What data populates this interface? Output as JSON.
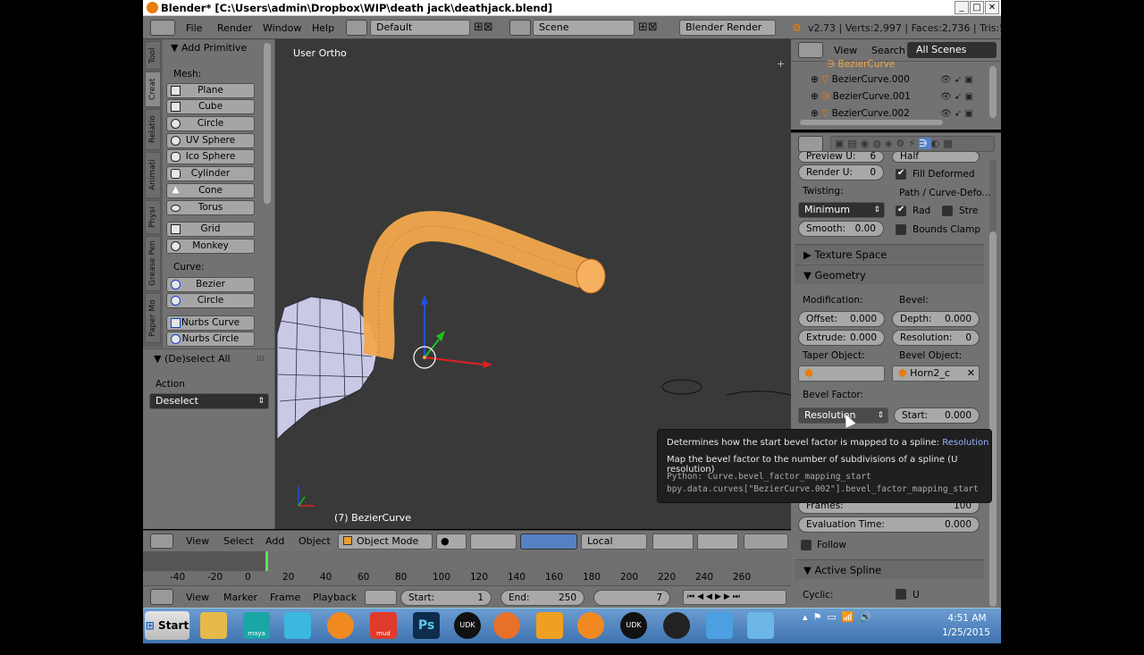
{
  "window": {
    "title": "Blender* [C:\\Users\\admin\\Dropbox\\WIP\\death jack\\deathjack.blend]",
    "min": "_",
    "max": "□",
    "close": "✕"
  },
  "topbar": {
    "menus": [
      "File",
      "Render",
      "Window",
      "Help"
    ],
    "layout": "Default",
    "scene": "Scene",
    "engine": "Blender Render",
    "stats": "v2.73 | Verts:2,997 | Faces:2,736 | Tris:5,51"
  },
  "toolshelf": {
    "tabs": [
      "Tool",
      "Creat",
      "Relatio",
      "Animati",
      "Physi",
      "Grease Pen",
      "Paper Mo"
    ],
    "add_primitive": "Add Primitive",
    "mesh_label": "Mesh:",
    "mesh": [
      "Plane",
      "Cube",
      "Circle",
      "UV Sphere",
      "Ico Sphere",
      "Cylinder",
      "Cone",
      "Torus"
    ],
    "other": [
      "Grid",
      "Monkey"
    ],
    "curve_label": "Curve:",
    "curves": [
      "Bezier",
      "Circle",
      "Nurbs Curve",
      "Nurbs Circle"
    ],
    "deselect_panel": "(De)select All",
    "action_label": "Action",
    "action_value": "Deselect"
  },
  "viewport": {
    "label": "User Ortho",
    "object": "(7) BezierCurve"
  },
  "vphdr": {
    "menus": [
      "View",
      "Select",
      "Add",
      "Object"
    ],
    "mode": "Object Mode",
    "pivot": "Local"
  },
  "timeline": {
    "ticks": [
      "-40",
      "-20",
      "0",
      "20",
      "40",
      "60",
      "80",
      "100",
      "120",
      "140",
      "160",
      "180",
      "200",
      "220",
      "240",
      "260"
    ]
  },
  "tlhdr": {
    "menus": [
      "View",
      "Marker",
      "Frame",
      "Playback"
    ],
    "start_label": "Start:",
    "start": "1",
    "end_label": "End:",
    "end": "250",
    "current": "7"
  },
  "outliner": {
    "menus": [
      "View",
      "Search"
    ],
    "filter": "All Scenes",
    "items": [
      "BezierCurve",
      "BezierCurve.000",
      "BezierCurve.001",
      "BezierCurve.002"
    ]
  },
  "props": {
    "preview_u": "Preview U:",
    "preview_u_val": "6",
    "render_u": "Render U:",
    "render_u_val": "0",
    "half": "Half",
    "fill_deformed": "Fill Deformed",
    "twisting": "Twisting:",
    "path_curve": "Path / Curve-Defo...",
    "twist_val": "Minimum",
    "rad": "Rad",
    "stre": "Stre",
    "smooth": "Smooth:",
    "smooth_val": "0.00",
    "bounds_clamp": "Bounds Clamp",
    "texture_space": "Texture Space",
    "geometry": "Geometry",
    "modification": "Modification:",
    "bevel": "Bevel:",
    "offset": "Offset:",
    "offset_val": "0.000",
    "depth": "Depth:",
    "depth_val": "0.000",
    "extrude": "Extrude:",
    "extrude_val": "0.000",
    "resolution": "Resolution:",
    "resolution_val": "0",
    "taper_object": "Taper Object:",
    "bevel_object": "Bevel Object:",
    "bevel_object_val": "Horn2_c",
    "bevel_factor": "Bevel Factor:",
    "bf_mapping": "Resolution",
    "bf_start": "Start:",
    "bf_start_val": "0.000",
    "frames": "Frames:",
    "frames_val": "100",
    "eval_time": "Evaluation Time:",
    "eval_time_val": "0.000",
    "follow": "Follow",
    "active_spline": "Active Spline",
    "cyclic": "Cyclic:",
    "u": "U"
  },
  "tooltip": {
    "line1": "Determines how the start bevel factor is mapped to a spline:",
    "line1_value": "Resolution",
    "line2": "Map the bevel factor to the number of subdivisions of a spline (U resolution)",
    "line3": "Python: Curve.bevel_factor_mapping_start",
    "line4": "bpy.data.curves[\"BezierCurve.002\"].bevel_factor_mapping_start"
  },
  "taskbar": {
    "start": "Start",
    "time": "4:51 AM",
    "date": "1/25/2015",
    "labels": [
      "maya",
      "mud",
      "Ps",
      "UDK",
      "UDK"
    ]
  },
  "colors": {
    "accent": "#e87d0d",
    "viewport": "#393939",
    "panel": "#727272",
    "tooltip": "#1f1f1f",
    "selection": "#f2a84c"
  }
}
